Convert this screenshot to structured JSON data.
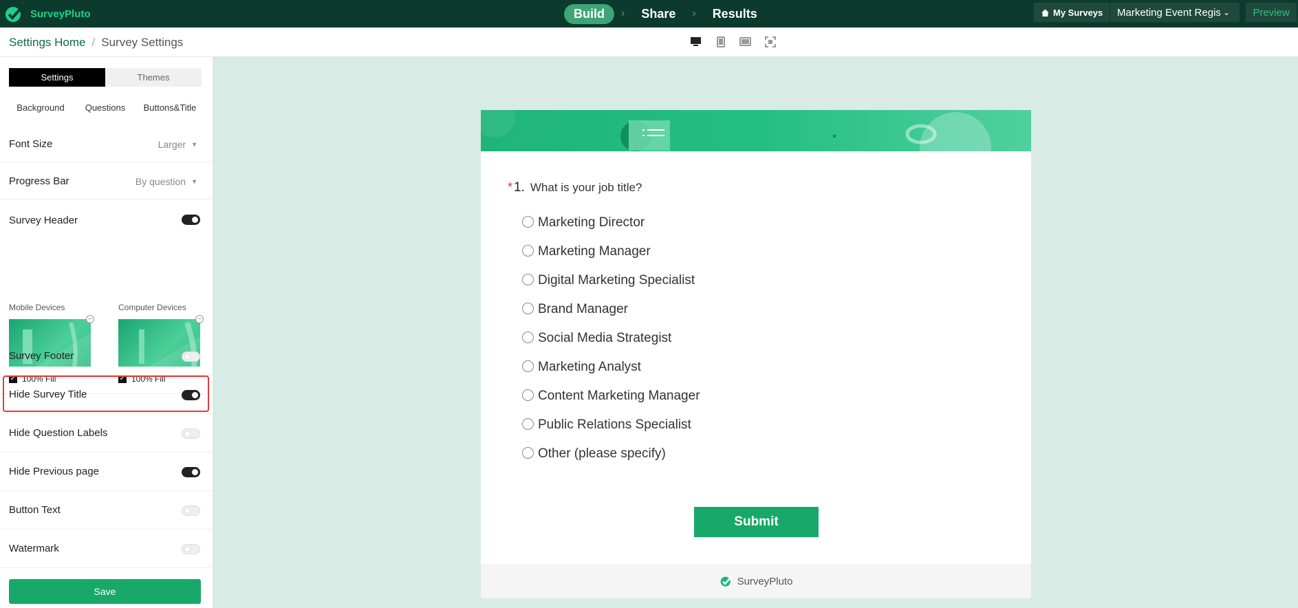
{
  "app": {
    "name": "SurveyPluto",
    "steps": [
      "Build",
      "Share",
      "Results"
    ],
    "my_surveys": "My Surveys",
    "survey_name": "Marketing Event Regist",
    "preview": "Preview"
  },
  "breadcrumb": {
    "home": "Settings Home",
    "separator": "/",
    "current": "Survey Settings"
  },
  "device_icons": [
    "desktop-view-icon",
    "mobile-view-icon",
    "tablet-view-icon",
    "fullscreen-icon"
  ],
  "sidebar": {
    "tabs": [
      "Settings",
      "Themes"
    ],
    "subtabs": [
      "Background",
      "Questions",
      "Buttons&Title"
    ],
    "font_size": {
      "label": "Font Size",
      "value": "Larger"
    },
    "progress_bar": {
      "label": "Progress Bar",
      "value": "By question"
    },
    "survey_header": {
      "label": "Survey Header",
      "on": true
    },
    "mobile_devices": {
      "label": "Mobile Devices",
      "fill_label": "100% Fill",
      "checked": true
    },
    "computer_devices": {
      "label": "Computer Devices",
      "fill_label": "100% Fill",
      "checked": true
    },
    "survey_footer": {
      "label": "Survey Footer",
      "on": false
    },
    "hide_survey_title": {
      "label": "Hide Survey Title",
      "on": true
    },
    "hide_question_labels": {
      "label": "Hide Question Labels",
      "on": false
    },
    "hide_previous_page": {
      "label": "Hide Previous page",
      "on": true
    },
    "button_text": {
      "label": "Button Text",
      "on": false
    },
    "watermark": {
      "label": "Watermark",
      "on": false
    },
    "save": "Save"
  },
  "survey": {
    "question_required": "*",
    "question_number": "1.",
    "question_text": "What is your job title?",
    "options": [
      "Marketing Director",
      "Marketing Manager",
      "Digital Marketing Specialist",
      "Brand Manager",
      "Social Media Strategist",
      "Marketing Analyst",
      "Content Marketing Manager",
      "Public Relations Specialist",
      "Other (please specify)"
    ],
    "submit": "Submit",
    "footer_brand": "SurveyPluto"
  },
  "colors": {
    "brand_green": "#17a86a",
    "topbar": "#0c3b2e",
    "canvas": "#d8ebe4",
    "highlight": "#e53935"
  }
}
